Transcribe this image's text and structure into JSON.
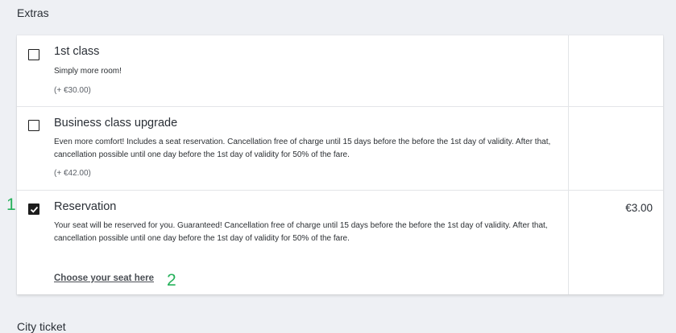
{
  "section": {
    "title": "Extras"
  },
  "extras": [
    {
      "title": "1st class",
      "description": "Simply more room!",
      "price_note": "(+ €30.00)",
      "checked": false,
      "price": ""
    },
    {
      "title": "Business class upgrade",
      "description": "Even more comfort! Includes a seat reservation. Cancellation free of charge until 15 days before the before the 1st day of validity. After that, cancellation possible until one day before the 1st day of validity for 50% of the fare.",
      "price_note": "(+ €42.00)",
      "checked": false,
      "price": ""
    },
    {
      "title": "Reservation",
      "description": "Your seat will be reserved for you. Guaranteed! Cancellation free of charge until 15 days before the before the 1st day of validity. After that, cancellation possible until one day before the 1st day of validity for 50% of the fare.",
      "price_note": "",
      "checked": true,
      "price": "€3.00",
      "link": "Choose your seat here"
    }
  ],
  "annotations": {
    "marker1": "1",
    "marker2": "2"
  },
  "next_section": {
    "title": "City ticket"
  },
  "colors": {
    "annotation": "#25b15a",
    "checkbox": "#1d1d1d"
  }
}
